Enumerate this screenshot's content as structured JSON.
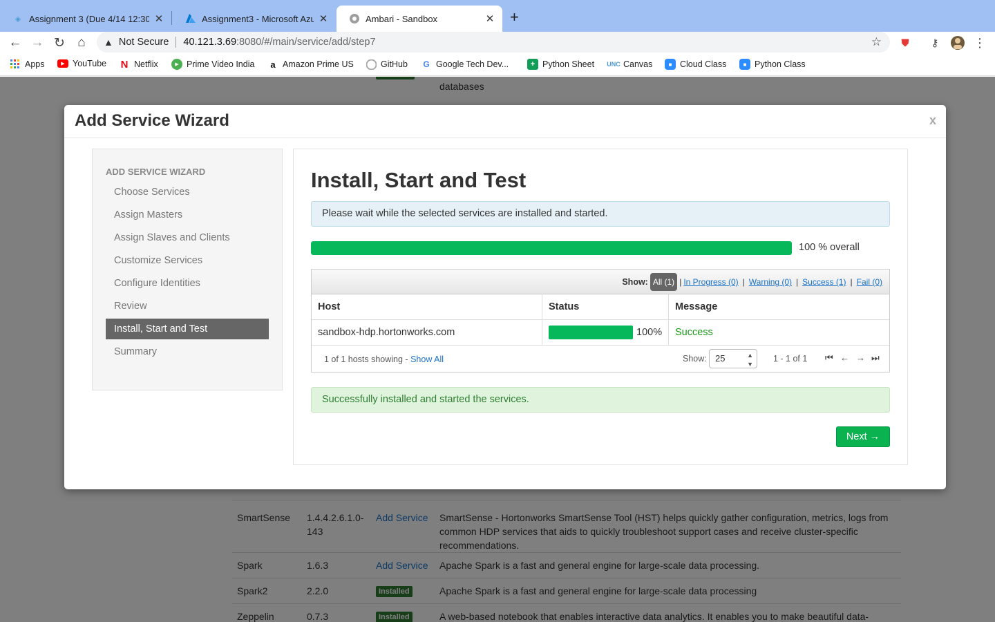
{
  "browser": {
    "tabs": [
      {
        "title": "Assignment 3 (Due 4/14 12:30p",
        "favicon": "canvas-icon",
        "close": "✕"
      },
      {
        "title": "Assignment3 - Microsoft Azure",
        "favicon": "azure-icon",
        "close": "✕"
      },
      {
        "title": "Ambari - Sandbox",
        "favicon": "ambari-icon",
        "close": "✕"
      }
    ],
    "new_tab": "+",
    "omnibox": {
      "security_label": "Not Secure",
      "url_host": "40.121.3.69",
      "url_rest": ":8080/#/main/service/add/step7"
    },
    "bookmarks": [
      {
        "label": "Apps",
        "icon": "apps-grid-icon",
        "color": "#4285f4"
      },
      {
        "label": "YouTube",
        "icon": "youtube-icon",
        "color": "#ff0000"
      },
      {
        "label": "Netflix",
        "icon": "netflix-icon",
        "color": "#e50914"
      },
      {
        "label": "Prime Video India",
        "icon": "prime-video-icon",
        "color": "#4caf50"
      },
      {
        "label": "Amazon Prime US",
        "icon": "amazon-icon",
        "color": "#111111"
      },
      {
        "label": "GitHub",
        "icon": "github-icon",
        "color": "#888888"
      },
      {
        "label": "Google Tech Dev...",
        "icon": "google-icon",
        "color": "#4285f4"
      },
      {
        "label": "Python Sheet",
        "icon": "sheets-icon",
        "color": "#0f9d58"
      },
      {
        "label": "Canvas",
        "icon": "unc-icon",
        "color": "#4b9cd3"
      },
      {
        "label": "Cloud Class",
        "icon": "zoom-icon",
        "color": "#2d8cff"
      },
      {
        "label": "Python Class",
        "icon": "zoom-icon",
        "color": "#2d8cff"
      }
    ]
  },
  "background_table": {
    "top_text": "databases",
    "rows": [
      {
        "name": "SmartSense",
        "version": "1.4.4.2.6.1.0-",
        "version2": "143",
        "action": "Add Service",
        "description": "SmartSense - Hortonworks SmartSense Tool (HST) helps quickly gather configuration, metrics, logs from",
        "description2": "common HDP services that aids to quickly troubleshoot support cases and receive cluster-specific",
        "description3": "recommendations."
      },
      {
        "name": "Spark",
        "version": "1.6.3",
        "action": "Add Service",
        "description": "Apache Spark is a fast and general engine for large-scale data processing."
      },
      {
        "name": "Spark2",
        "version": "2.2.0",
        "badge": "Installed",
        "description": "Apache Spark is a fast and general engine for large-scale data processing"
      },
      {
        "name": "Zeppelin",
        "version": "0.7.3",
        "badge": "Installed",
        "description": "A web-based notebook that enables interactive data analytics. It enables you to make beautiful data-"
      }
    ]
  },
  "modal": {
    "title": "Add Service Wizard",
    "close": "x",
    "sidebar": {
      "heading": "ADD SERVICE WIZARD",
      "items": [
        "Choose Services",
        "Assign Masters",
        "Assign Slaves and Clients",
        "Customize Services",
        "Configure Identities",
        "Review",
        "Install, Start and Test",
        "Summary"
      ],
      "active_index": 6
    },
    "step": {
      "title": "Install, Start and Test",
      "info_message": "Please wait while the selected services are installed and started.",
      "overall_progress": 100,
      "overall_text": "100 % overall",
      "filters": {
        "show_label": "Show:",
        "all": "All (1)",
        "in_progress": "In Progress (0)",
        "warning": "Warning (0)",
        "success": "Success (1)",
        "fail": "Fail (0)",
        "separator": "|"
      },
      "table": {
        "headers": [
          "Host",
          "Status",
          "Message"
        ],
        "rows": [
          {
            "host": "sandbox-hdp.hortonworks.com",
            "progress": 100,
            "progress_text": "100%",
            "message": "Success"
          }
        ]
      },
      "footer": {
        "count_text": "1 of 1 hosts showing - ",
        "show_all": "Show All",
        "show_label": "Show:",
        "page_size": "25",
        "range_text": "1 - 1 of 1"
      },
      "success_message": "Successfully installed and started the services.",
      "next_label": "Next →"
    }
  },
  "colors": {
    "progress_green": "#06b85a",
    "next_button": "#0ab350",
    "link_blue": "#1a73c8",
    "tabstrip": "#a0c0f4"
  }
}
